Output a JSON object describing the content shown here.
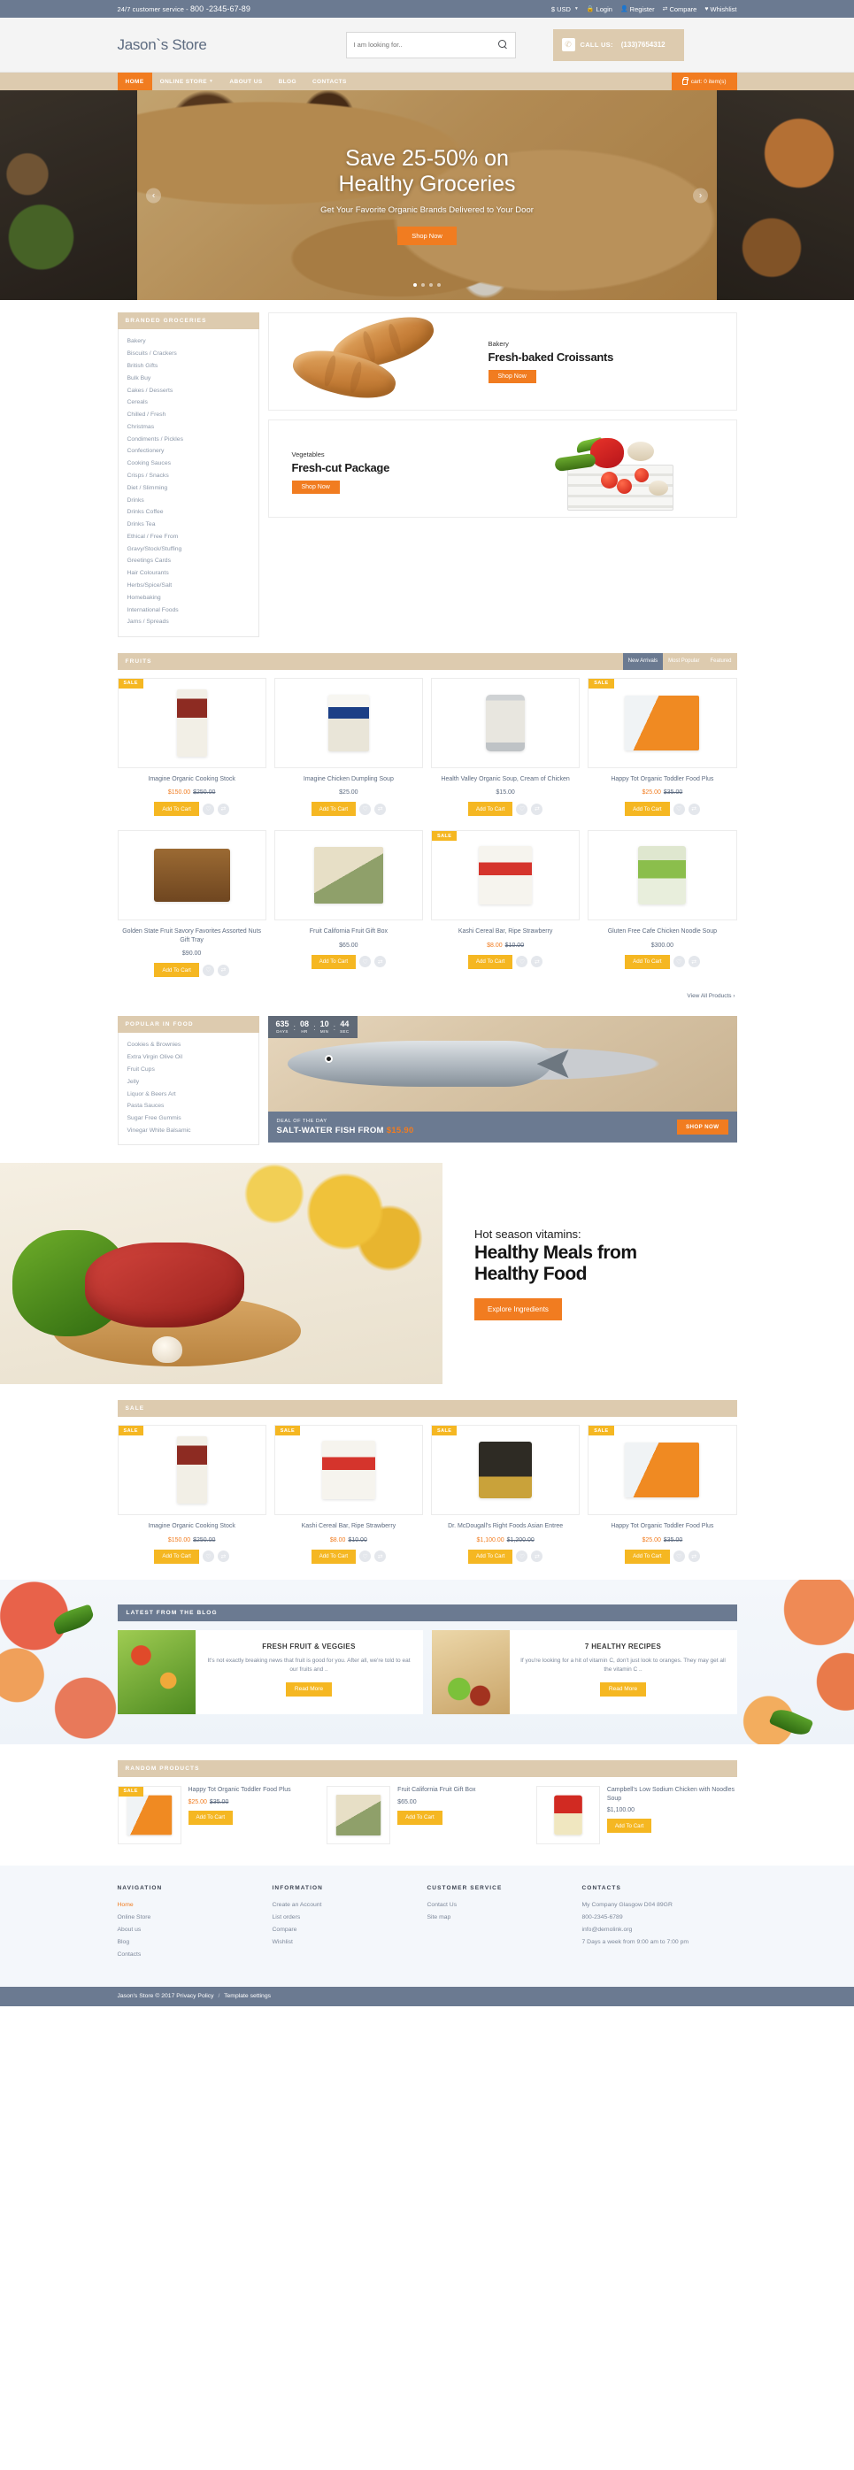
{
  "topbar": {
    "service_label": "24/7 customer service -",
    "phone": "800 -2345-67-89",
    "currency": "$ USD",
    "links": [
      {
        "label": "Login",
        "icon": "lock-icon"
      },
      {
        "label": "Register",
        "icon": "user-icon"
      },
      {
        "label": "Compare",
        "icon": "compare-icon"
      },
      {
        "label": "Whishlist",
        "icon": "heart-icon"
      }
    ]
  },
  "header": {
    "logo": "Jason`s Store",
    "search_placeholder": "I am looking for..",
    "search_value": "",
    "call_label": "CALL US:",
    "call_number": "(133)7654312"
  },
  "nav": {
    "items": [
      {
        "label": "HOME",
        "active": true
      },
      {
        "label": "ONLINE STORE",
        "active": false,
        "caret": true
      },
      {
        "label": "ABOUT US",
        "active": false
      },
      {
        "label": "BLOG",
        "active": false
      },
      {
        "label": "CONTACTS",
        "active": false
      }
    ],
    "cart_label": "cart: 0 item(s)"
  },
  "hero": {
    "title_line1": "Save 25-50% on",
    "title_line2": "Healthy Groceries",
    "subtitle": "Get Your Favorite Organic Brands Delivered to Your Door",
    "button": "Shop Now",
    "dots": 4,
    "active_dot": 1
  },
  "categories": {
    "heading": "BRANDED GROCERIES",
    "items": [
      "Bakery",
      "Biscuits / Crackers",
      "British Gifts",
      "Bulk Buy",
      "Cakes / Desserts",
      "Cereals",
      "Chilled / Fresh",
      "Christmas",
      "Condiments / Pickles",
      "Confectionery",
      "Cooking Sauces",
      "Crisps / Snacks",
      "Diet / Slimming",
      "Drinks",
      "Drinks Coffee",
      "Drinks Tea",
      "Ethical / Free From",
      "Gravy/Stock/Stuffing",
      "Greetings Cards",
      "Hair Colourants",
      "Herbs/Spice/Salt",
      "Homebaking",
      "International Foods",
      "Jams / Spreads"
    ]
  },
  "promos": [
    {
      "kicker": "Bakery",
      "title": "Fresh-baked Croissants",
      "button": "Shop Now",
      "image": "croissants",
      "text_side": "right"
    },
    {
      "kicker": "Vegetables",
      "title": "Fresh-cut Package",
      "button": "Shop Now",
      "image": "vegetable-crate",
      "text_side": "left"
    }
  ],
  "fruits_section": {
    "title": "FRUITS",
    "tabs": [
      {
        "label": "New Arrivals",
        "active": true
      },
      {
        "label": "Most Popular",
        "active": false
      },
      {
        "label": "Featured",
        "active": false
      }
    ],
    "view_all": "View All Products",
    "cart_button": "Add To Cart",
    "sale_badge": "SALE",
    "row1": [
      {
        "name": "Imagine Organic Cooking Stock",
        "price_new": "$150.00",
        "price_old": "$250.00",
        "sale": true,
        "art": "box-red"
      },
      {
        "name": "Imagine Chicken Dumpling Soup",
        "price_new": "$25.00",
        "price_old": "",
        "sale": false,
        "art": "carton-blue"
      },
      {
        "name": "Health Valley Organic Soup, Cream of Chicken",
        "price_new": "$15.00",
        "price_old": "",
        "sale": false,
        "art": "can-grey"
      },
      {
        "name": "Happy Tot Organic Toddler Food Plus",
        "price_new": "$25.00",
        "price_old": "$35.00",
        "sale": true,
        "art": "pouch-orange"
      }
    ],
    "row2": [
      {
        "name": "Golden State Fruit Savory Favorites Assorted Nuts Gift Tray",
        "price_new": "$90.00",
        "price_old": "",
        "sale": false,
        "art": "nut-tray"
      },
      {
        "name": "Fruit California Fruit Gift Box",
        "price_new": "$65.00",
        "price_old": "",
        "sale": false,
        "art": "fruit-box"
      },
      {
        "name": "Kashi Cereal Bar, Ripe Strawberry",
        "price_new": "$8.00",
        "price_old": "$10.00",
        "sale": true,
        "art": "kashi-box"
      },
      {
        "name": "Gluten Free Cafe Chicken Noodle Soup",
        "price_new": "$300.00",
        "price_old": "",
        "sale": false,
        "art": "gluten-can"
      }
    ]
  },
  "popular": {
    "heading": "POPULAR IN FOOD",
    "items": [
      "Cookies & Brownies",
      "Extra Virgin Olive Oil",
      "Fruit Cups",
      "Jelly",
      "Liquor & Beers Art",
      "Pasta Sauces",
      "Sugar Free Gummis",
      "Vinegar White Balsamic"
    ]
  },
  "deal": {
    "countdown": [
      {
        "value": "635",
        "unit": "DAYS"
      },
      {
        "value": "08",
        "unit": "HR"
      },
      {
        "value": "10",
        "unit": "MIN"
      },
      {
        "value": "44",
        "unit": "SEC"
      }
    ],
    "kicker": "DEAL OF THE DAY",
    "title_prefix": "SALT-WATER FISH FROM",
    "amount": "$15.90",
    "button": "SHOP NOW"
  },
  "vitamins": {
    "kicker": "Hot season vitamins:",
    "title_line1": "Healthy Meals from",
    "title_line2": "Healthy Food",
    "button": "Explore Ingredients"
  },
  "sale_section": {
    "title": "SALE",
    "cart_button": "Add To Cart",
    "sale_badge": "SALE",
    "products": [
      {
        "name": "Imagine Organic Cooking Stock",
        "price_new": "$150.00",
        "price_old": "$250.00",
        "sale": true,
        "art": "box-red"
      },
      {
        "name": "Kashi Cereal Bar, Ripe Strawberry",
        "price_new": "$8.00",
        "price_old": "$10.00",
        "sale": true,
        "art": "kashi-box"
      },
      {
        "name": "Dr. McDougall's Right Foods Asian Entree",
        "price_new": "$1,100.00",
        "price_old": "$1,200.00",
        "sale": true,
        "art": "noodle-cup"
      },
      {
        "name": "Happy Tot Organic Toddler Food Plus",
        "price_new": "$25.00",
        "price_old": "$35.00",
        "sale": true,
        "art": "pouch-orange"
      }
    ]
  },
  "blog": {
    "heading": "LATEST FROM THE BLOG",
    "read_more": "Read More",
    "posts": [
      {
        "title": "FRESH FRUIT & VEGGIES",
        "excerpt": "It's not exactly breaking news that fruit is good for you. After all, we're told to eat our fruits and ..",
        "image": "salad"
      },
      {
        "title": "7 HEALTHY RECIPES",
        "excerpt": "If you're looking for a hit of vitamin C, don't just look to oranges. They may get all the vitamin C ..",
        "image": "bread-fruit"
      }
    ]
  },
  "random": {
    "heading": "RANDOM PRODUCTS",
    "cart_button": "Add To Cart",
    "sale_badge": "SALE",
    "items": [
      {
        "name": "Happy Tot Organic Toddler Food Plus",
        "price_new": "$25.00",
        "price_old": "$35.00",
        "sale": true,
        "art": "pouch-orange"
      },
      {
        "name": "Fruit California Fruit Gift Box",
        "price_new": "$65.00",
        "price_old": "",
        "sale": false,
        "art": "fruit-box"
      },
      {
        "name": "Campbell's Low Sodium Chicken with Noodles Soup",
        "price_new": "$1,100.00",
        "price_old": "",
        "sale": false,
        "art": "campbell-can"
      }
    ]
  },
  "footer": {
    "columns": [
      {
        "heading": "NAVIGATION",
        "links": [
          {
            "label": "Home",
            "active": true
          },
          {
            "label": "Online Store",
            "active": false
          },
          {
            "label": "About us",
            "active": false
          },
          {
            "label": "Blog",
            "active": false
          },
          {
            "label": "Contacts",
            "active": false
          }
        ]
      },
      {
        "heading": "INFORMATION",
        "links": [
          {
            "label": "Create an Account",
            "active": false
          },
          {
            "label": "List orders",
            "active": false
          },
          {
            "label": "Compare",
            "active": false
          },
          {
            "label": "Wishlist",
            "active": false
          }
        ]
      },
      {
        "heading": "CUSTOMER SERVICE",
        "links": [
          {
            "label": "Contact Us",
            "active": false
          },
          {
            "label": "Site map",
            "active": false
          }
        ]
      },
      {
        "heading": "CONTACTS",
        "links": [
          {
            "label": "My Company Glasgow D04 89GR",
            "active": false
          },
          {
            "label": "800-2345-6789",
            "active": false
          },
          {
            "label": "info@demolink.org",
            "active": false
          },
          {
            "label": "7 Days a week from 9:00 am to 7:00 pm",
            "active": false
          }
        ]
      }
    ],
    "copyright": "Jason's Store © 2017",
    "privacy": "Privacy Policy",
    "template": "Template settings"
  },
  "colors": {
    "accent_orange": "#f17c20",
    "accent_yellow": "#f5b722",
    "beige": "#ddcbaf",
    "slate": "#6b7a91"
  }
}
